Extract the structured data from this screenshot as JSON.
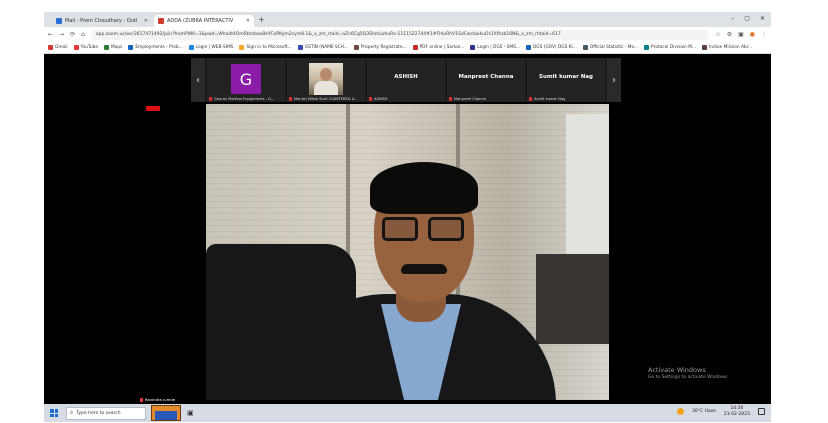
{
  "browser": {
    "tabs": [
      {
        "title": "Mail - Prem Choudhary - Outl",
        "favicon_color": "#2a6cd6",
        "close": "✕"
      },
      {
        "title": "ADDA (ZUBRA INTERACTIV",
        "favicon_color": "#d33b2f",
        "close": "✕"
      }
    ],
    "new_tab": "+",
    "window_controls": [
      "–",
      "▢",
      "✕"
    ],
    "nav": {
      "back": "←",
      "forward": "→",
      "reload": "⟳",
      "home": "⌂"
    },
    "url": "app.zoom.us/wc/3617471492/join?fromPWA=1&pwd=Whadt4OmRbmbax8eYCaPKym2cym8.1&_x_zm_rtaid=aZn6Cg5Q3ShmLohuRx-1111522744#1#FhIuRhV1SdCwcbwkuOs1Xfhsb16N&_x_zm_rhtaid=617",
    "addr_icons": [
      "☆",
      "⚙",
      "▣",
      "●",
      "⋮"
    ],
    "bookmarks": [
      {
        "label": "Gmail",
        "color": "#d33b2f"
      },
      {
        "label": "YouTube",
        "color": "#e53935"
      },
      {
        "label": "Maps",
        "color": "#2e7d32"
      },
      {
        "label": "Employments - Prob...",
        "color": "#1565c0"
      },
      {
        "label": "Login | WEB-SIMS",
        "color": "#1e88e5"
      },
      {
        "label": "Sign in to Microsoft...",
        "color": "#f9a825"
      },
      {
        "label": "GSTIN (NAME SCH...",
        "color": "#3949ab"
      },
      {
        "label": "Property Registrate...",
        "color": "#6d4c41"
      },
      {
        "label": "PDF online | Sarkar...",
        "color": "#c62828"
      },
      {
        "label": "Login | DGS - SMS...",
        "color": "#283593"
      },
      {
        "label": "DGS (GOV) DGS Ki...",
        "color": "#1565c0"
      },
      {
        "label": "Official Statistic - Mo...",
        "color": "#455a64"
      },
      {
        "label": "Protocol Division M...",
        "color": "#00838f"
      },
      {
        "label": "Indian Mission Abr...",
        "color": "#5d4037"
      }
    ]
  },
  "meeting": {
    "participants": [
      {
        "type": "initial",
        "initial": "G",
        "avatar_color": "#8a1ca8",
        "caption": "Gaurav Medical Equipments - G..."
      },
      {
        "type": "photo",
        "caption": "Manish Mittal Stuti CHARTERED A..."
      },
      {
        "type": "name",
        "name": "ASHISH",
        "caption": "ASHISH"
      },
      {
        "type": "name",
        "name": "Manpreet Channa",
        "caption": "Manpreet Channa"
      },
      {
        "type": "name",
        "name": "Sumit kumar Nag",
        "caption": "Sumit kumar Nag"
      }
    ],
    "prev_arrow": "‹",
    "next_arrow": "›",
    "self_name": "Ravindra Jumde"
  },
  "activation": {
    "title": "Activate Windows",
    "subtitle": "Go to Settings to activate Windows."
  },
  "taskbar": {
    "search_placeholder": "Type here to search",
    "search_icon": "⌕",
    "app_icon": "▣",
    "weather": "30°C Haze",
    "time": "14:30",
    "date": "21-02-2023"
  }
}
